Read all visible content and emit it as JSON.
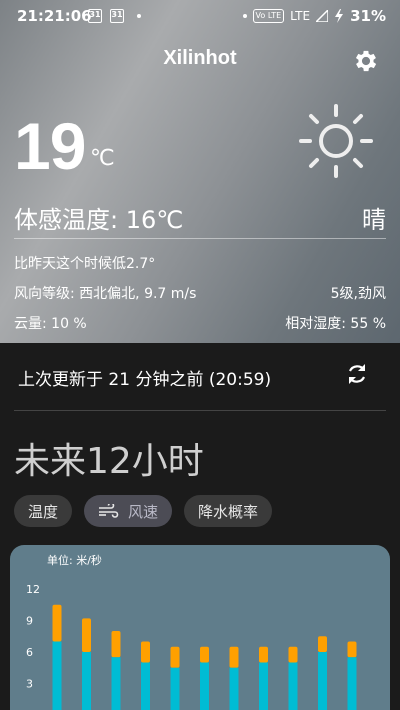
{
  "status_bar": {
    "time": "21:21:06",
    "calendar_day_1": "31",
    "calendar_day_2": "31",
    "volte": "Vo LTE",
    "network": "LTE",
    "battery": "31%"
  },
  "header": {
    "city": "Xilinhot",
    "settings_icon": "gear-icon"
  },
  "current": {
    "temperature": "19",
    "unit": "℃",
    "condition_icon": "sun-icon",
    "feels_like": "体感温度: 16℃",
    "condition": "晴",
    "compare_yesterday": "比昨天这个时候低2.7°",
    "wind": "风向等级: 西北偏北, 9.7 m/s",
    "wind_level": "5级,劲风",
    "cloud": "云量: 10 %",
    "humidity": "相对湿度: 55 %"
  },
  "update": {
    "text": "上次更新于 21 分钟之前 (20:59)",
    "refresh_icon": "refresh-icon"
  },
  "forecast": {
    "title": "未来12小时",
    "tabs": [
      {
        "label": "温度",
        "active": false
      },
      {
        "label": "风速",
        "active": true,
        "icon": "wind-icon"
      },
      {
        "label": "降水概率",
        "active": false
      }
    ]
  },
  "colors": {
    "chart_bg": "#607d8b",
    "bar_base": "#00bcd4",
    "bar_top": "#ffa000"
  },
  "chart_data": {
    "type": "bar",
    "unit_label": "单位: 米/秒",
    "y_ticks": [
      3,
      6,
      9,
      12
    ],
    "series": [
      {
        "values": [
          7.0,
          6.0,
          5.5,
          5.0,
          4.5,
          5.0,
          4.5,
          5.0,
          5.0,
          6.0,
          5.5
        ]
      },
      {
        "values": [
          10.5,
          9.2,
          8.0,
          7.0,
          6.5,
          6.5,
          6.5,
          6.5,
          6.5,
          7.5,
          7.0
        ]
      }
    ],
    "ylim": [
      0,
      13
    ]
  }
}
